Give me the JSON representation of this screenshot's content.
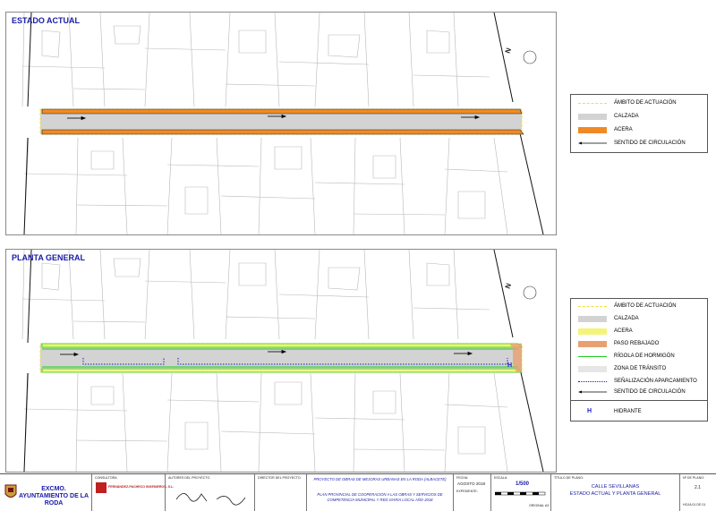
{
  "top_panel": {
    "title": "ESTADO ACTUAL",
    "legend": [
      {
        "label": "ÁMBITO DE ACTUACIÓN",
        "style": "dashed-yellow"
      },
      {
        "label": "CALZADA",
        "style": "grey-fill"
      },
      {
        "label": "ACERA",
        "style": "orange-fill"
      },
      {
        "label": "SENTIDO DE CIRCULACIÓN",
        "style": "arrow"
      }
    ]
  },
  "bottom_panel": {
    "title": "PLANTA GENERAL",
    "legend": [
      {
        "label": "ÁMBITO DE ACTUACIÓN",
        "style": "dashed-yellow"
      },
      {
        "label": "CALZADA",
        "style": "grey-fill"
      },
      {
        "label": "ACERA",
        "style": "yellow-fill"
      },
      {
        "label": "PASO REBAJADO",
        "style": "salmon-fill"
      },
      {
        "label": "RÍGOLA DE HORMIGÓN",
        "style": "green-line"
      },
      {
        "label": "ZONA DE TRÁNSITO",
        "style": "light-grey-fill"
      },
      {
        "label": "SEÑALIZACIÓN APARCAMIENTO",
        "style": "blue-dotted"
      },
      {
        "label": "SENTIDO DE CIRCULACIÓN",
        "style": "arrow"
      },
      {
        "label": "HIDRANTE",
        "style": "hydrant-H"
      }
    ]
  },
  "colors": {
    "acera_actual": "#f08a24",
    "acera_nueva": "#f4f47a",
    "calzada": "#d3d3d3",
    "rigola": "#22cc22",
    "senalizacion": "#1a1acc",
    "ambito": "#f0e040",
    "paso_rebajado": "#e8a070",
    "title_blue": "#1a1aa8"
  },
  "north_label": "N",
  "hydrant_label": "H",
  "title_block": {
    "entity": "EXCMO. AYUNTAMIENTO DE LA RODA",
    "consultora_label": "CONSULTORA",
    "consultora_name": "FERNÁNDEZ-PACHECO INGENIEROS, S.L.",
    "autores_label": "AUTORES DEL PROYECTO",
    "director_label": "DIRECTOR DEL PROYECTO",
    "project_line1": "PROYECTO DE OBRAS DE MEJORAS URBANAS EN LA RODA (ALBACETE)",
    "project_line2": "PLAN PROVINCIAL DE COOPERACIÓN A LAS OBRAS Y SERVICIOS DE COMPETENCIA MUNICIPAL Y RED VIARIA LOCAL AÑO 2018",
    "fecha_label": "FECHA:",
    "fecha": "AGOSTO 2018",
    "expediente_label": "EXPEDIENTE:",
    "escala_label": "ESCALA:",
    "escala": "1/500",
    "original_label": "ORIGINAL A3",
    "titulo_label": "TÍTULO DE PLANO:",
    "plan_title1": "CALLE SEVILLANAS",
    "plan_title2": "ESTADO ACTUAL Y PLANTA GENERAL",
    "plano_label": "Nº DE PLANO:",
    "plano": "2.1",
    "hoja": "HOJA 01 DE 01"
  }
}
